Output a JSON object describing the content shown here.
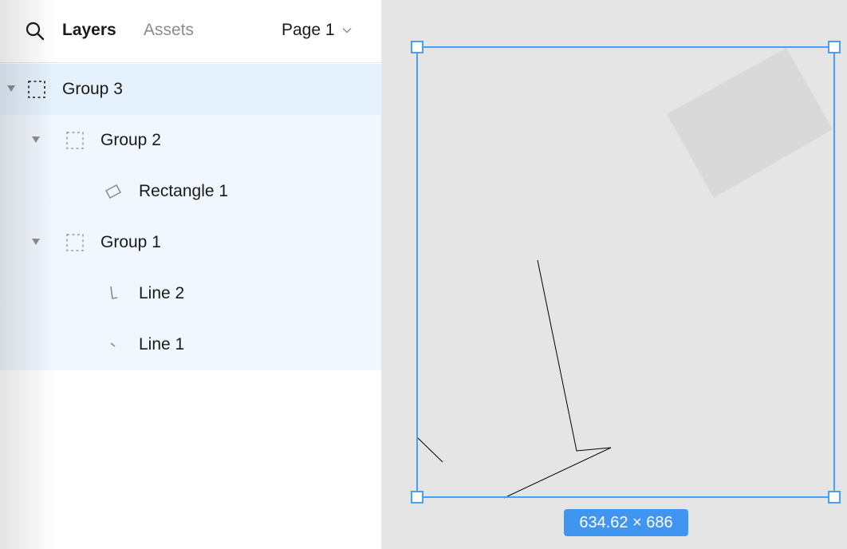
{
  "header": {
    "tabs": [
      {
        "label": "Layers",
        "active": true
      },
      {
        "label": "Assets",
        "active": false
      }
    ],
    "page_selector": {
      "label": "Page 1"
    }
  },
  "layers": [
    {
      "label": "Group 3",
      "type": "group",
      "level": 0,
      "expanded": true,
      "selected": true
    },
    {
      "label": "Group 2",
      "type": "group",
      "level": 1,
      "expanded": true
    },
    {
      "label": "Rectangle 1",
      "type": "rectangle",
      "level": 2
    },
    {
      "label": "Group 1",
      "type": "group",
      "level": 1,
      "expanded": true
    },
    {
      "label": "Line 2",
      "type": "line",
      "level": 2
    },
    {
      "label": "Line 1",
      "type": "line",
      "level": 2
    }
  ],
  "canvas": {
    "selection_size": "634.62 × 686",
    "colors": {
      "selection": "#4a9ff5",
      "shape_fill": "#d9d9d9",
      "line_stroke": "#000000",
      "canvas_bg": "#e5e5e5"
    }
  }
}
